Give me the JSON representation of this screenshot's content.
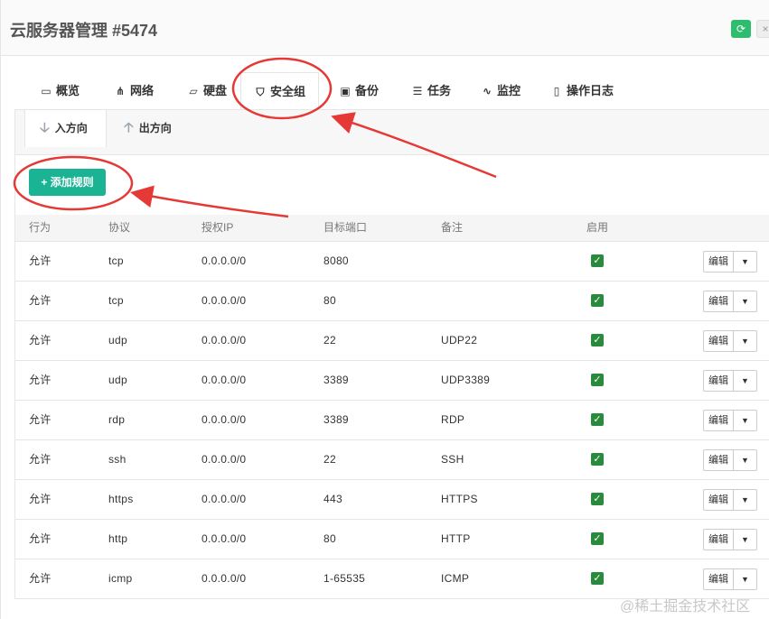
{
  "header": {
    "title": "云服务器管理 #5474",
    "refresh_icon": "refresh-icon",
    "close_icon": "close-icon",
    "accent_color": "#2ebd6e"
  },
  "tabs": [
    {
      "label": "概览",
      "icon": "monitor-icon",
      "glyph": "▭"
    },
    {
      "label": "网络",
      "icon": "network-icon",
      "glyph": "⋔"
    },
    {
      "label": "硬盘",
      "icon": "harddisk-icon",
      "glyph": "▱"
    },
    {
      "label": "安全组",
      "icon": "shield-icon",
      "glyph": "⛉",
      "active": true
    },
    {
      "label": "备份",
      "icon": "save-icon",
      "glyph": "▣"
    },
    {
      "label": "任务",
      "icon": "tasks-icon",
      "glyph": "☰"
    },
    {
      "label": "监控",
      "icon": "pulse-icon",
      "glyph": "∿"
    },
    {
      "label": "操作日志",
      "icon": "file-icon",
      "glyph": "▯"
    }
  ],
  "subtabs": [
    {
      "label": "入方向",
      "icon": "arrow-down-icon",
      "glyph": "🡣",
      "active": true
    },
    {
      "label": "出方向",
      "icon": "arrow-up-icon",
      "glyph": "🡡"
    }
  ],
  "add_rule": {
    "label": "添加规则",
    "icon": "plus-icon",
    "glyph": "+",
    "color": "#1ab394"
  },
  "table": {
    "headers": [
      "行为",
      "协议",
      "授权IP",
      "目标端口",
      "备注",
      "启用"
    ],
    "rows": [
      {
        "action": "允许",
        "protocol": "tcp",
        "ip": "0.0.0.0/0",
        "port": "8080",
        "note": "",
        "enabled": true
      },
      {
        "action": "允许",
        "protocol": "tcp",
        "ip": "0.0.0.0/0",
        "port": "80",
        "note": "",
        "enabled": true
      },
      {
        "action": "允许",
        "protocol": "udp",
        "ip": "0.0.0.0/0",
        "port": "22",
        "note": "UDP22",
        "enabled": true
      },
      {
        "action": "允许",
        "protocol": "udp",
        "ip": "0.0.0.0/0",
        "port": "3389",
        "note": "UDP3389",
        "enabled": true
      },
      {
        "action": "允许",
        "protocol": "rdp",
        "ip": "0.0.0.0/0",
        "port": "3389",
        "note": "RDP",
        "enabled": true
      },
      {
        "action": "允许",
        "protocol": "ssh",
        "ip": "0.0.0.0/0",
        "port": "22",
        "note": "SSH",
        "enabled": true
      },
      {
        "action": "允许",
        "protocol": "https",
        "ip": "0.0.0.0/0",
        "port": "443",
        "note": "HTTPS",
        "enabled": true
      },
      {
        "action": "允许",
        "protocol": "http",
        "ip": "0.0.0.0/0",
        "port": "80",
        "note": "HTTP",
        "enabled": true
      },
      {
        "action": "允许",
        "protocol": "icmp",
        "ip": "0.0.0.0/0",
        "port": "1-65535",
        "note": "ICMP",
        "enabled": true
      }
    ],
    "edit_label": "编辑",
    "dropdown_icon": "caret-down-icon"
  },
  "annotation_color": "#e53935",
  "watermark": "@稀土掘金技术社区"
}
